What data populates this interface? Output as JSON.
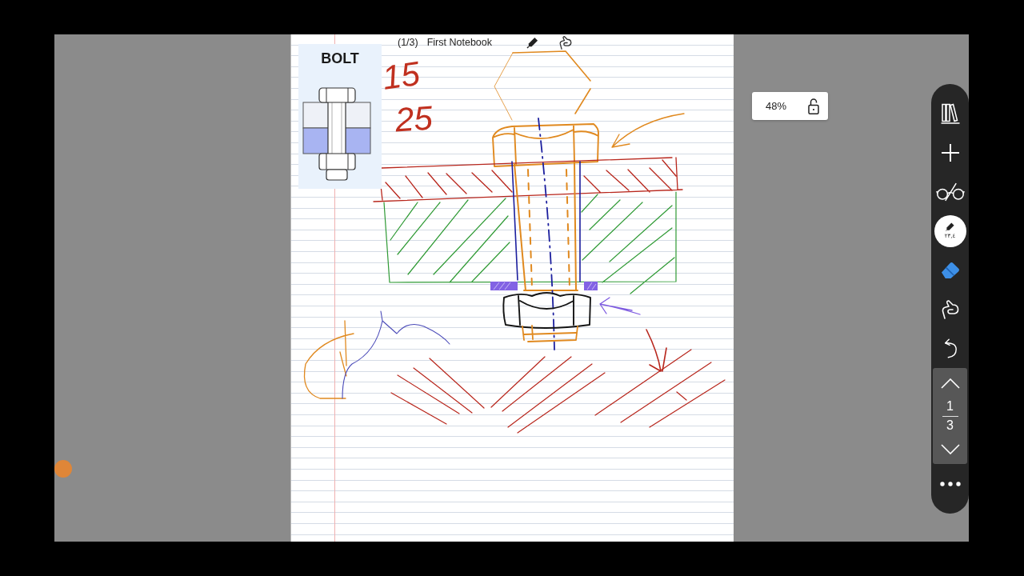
{
  "page_header": {
    "page_indicator": "(1/3)",
    "notebook_title": "First Notebook"
  },
  "reference_card": {
    "title": "BOLT"
  },
  "handwritten_notes": [
    {
      "text": "15"
    },
    {
      "text": "25"
    }
  ],
  "zoom": {
    "value": "48%",
    "locked": false
  },
  "toolbar": {
    "items": [
      {
        "kind": "library",
        "selected": false
      },
      {
        "kind": "add",
        "selected": false
      },
      {
        "kind": "read_mode",
        "selected": false
      },
      {
        "kind": "pen",
        "selected": true,
        "label": "٢٣,٤"
      },
      {
        "kind": "eraser",
        "selected": false
      },
      {
        "kind": "lasso",
        "selected": false
      },
      {
        "kind": "undo",
        "selected": false
      }
    ],
    "page_nav": {
      "current": "1",
      "total": "3"
    }
  }
}
